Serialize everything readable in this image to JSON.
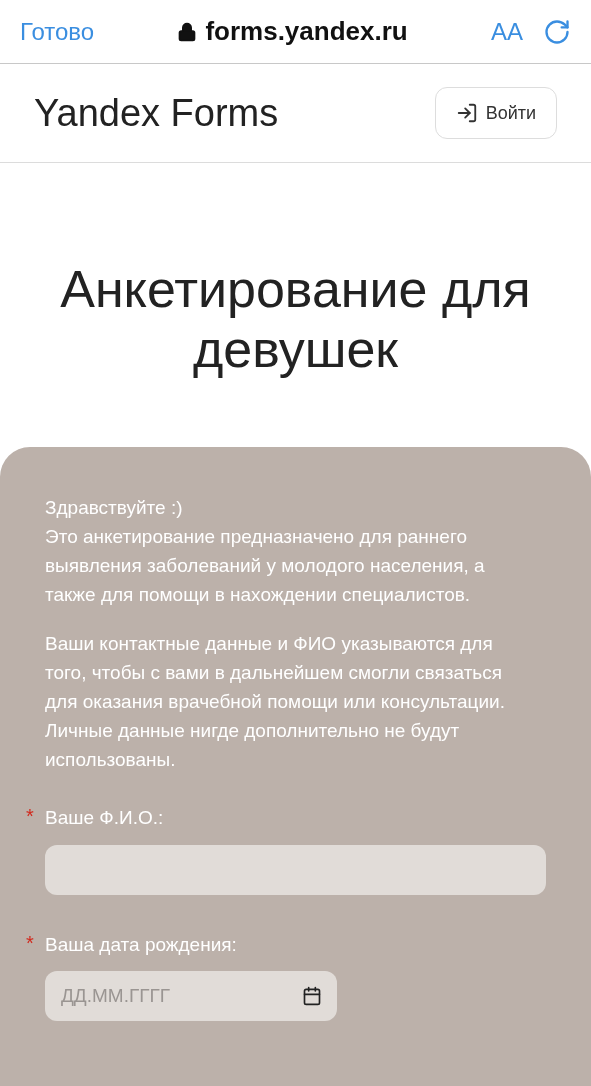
{
  "browser_bar": {
    "done": "Готово",
    "address": "forms.yandex.ru",
    "text_size": "AA"
  },
  "header": {
    "logo": "Yandex Forms",
    "login_button": "Войти"
  },
  "form": {
    "title": "Анкетирование для девушек",
    "intro": [
      [
        "Здравствуйте :)",
        "Это анкетирование предназначено для раннего выявления заболеваний у молодого населения, а также для помощи в нахождении специалистов."
      ],
      [
        "Ваши контактные данные и ФИО указываются для того, чтобы с вами в дальнейшем смогли связаться для оказания врачебной помощи или консультации.",
        "Личные данные нигде дополнительно не будут использованы."
      ]
    ],
    "required_marker": "*",
    "questions": [
      {
        "kind": "text",
        "label": "Ваше Ф.И.О.:",
        "required": true
      },
      {
        "kind": "date",
        "label": "Ваша дата рождения:",
        "required": true,
        "placeholder": "ДД.ММ.ГГГГ"
      }
    ]
  }
}
